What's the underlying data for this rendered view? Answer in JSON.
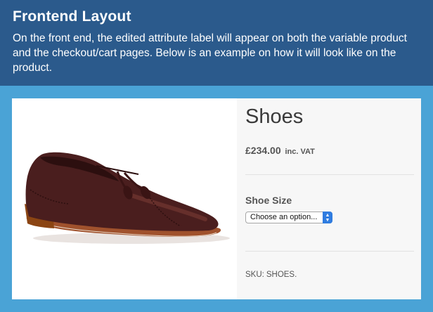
{
  "header": {
    "title": "Frontend Layout",
    "text": "On the front end, the edited attribute label will appear on both the variable product and the checkout/cart pages. Below is an example on how it will look like on the product."
  },
  "product": {
    "title": "Shoes",
    "price": "£234.00",
    "price_suffix": "inc. VAT",
    "attribute_label": "Shoe Size",
    "select_value": "Choose an option...",
    "sku_label": "SKU:",
    "sku_value": "SHOES.",
    "image": "brown-leather-tassel-loafer"
  },
  "colors": {
    "header_bg": "#2b5a8c",
    "page_bg": "#4aa3d6",
    "select_arrow": "#2f7ce0",
    "shoe": "#4a1e1e",
    "sole": "#a0522d"
  }
}
